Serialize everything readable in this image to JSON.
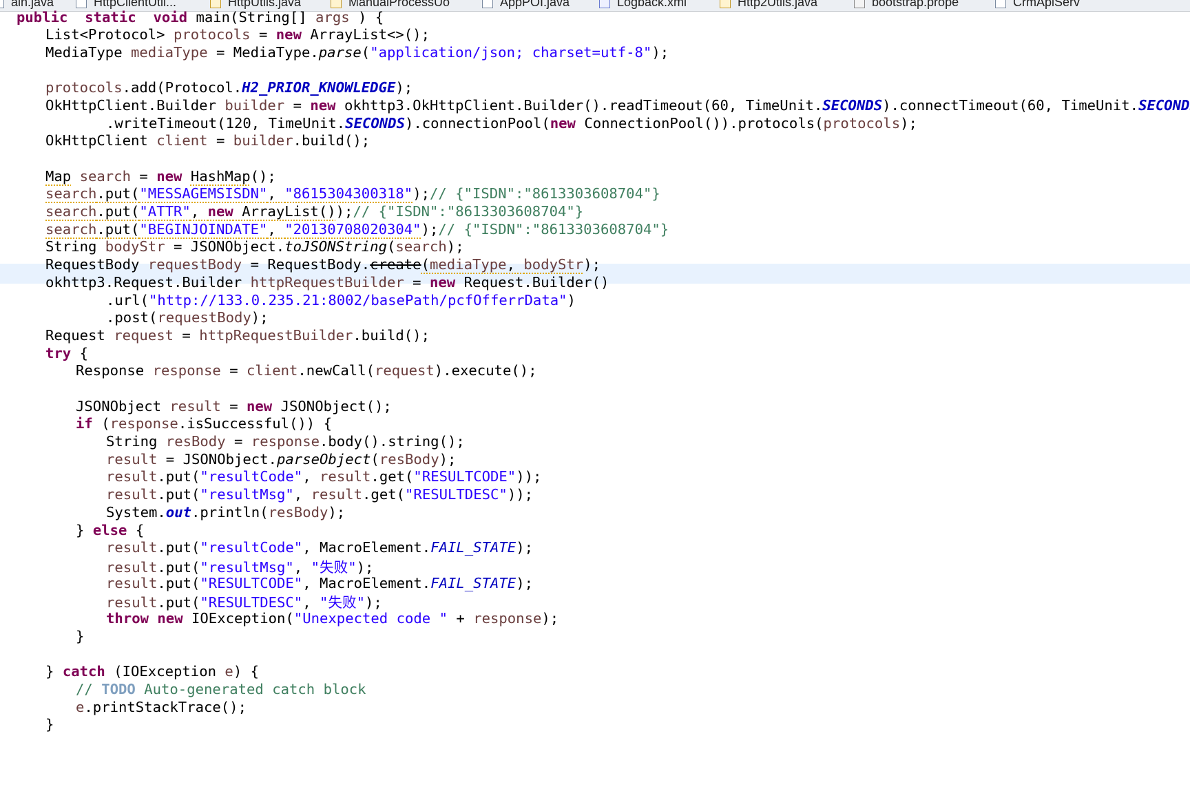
{
  "tabs": [
    {
      "label": "ain.java",
      "icon": "java-file-icon"
    },
    {
      "label": "HttpClientUtil...",
      "icon": "java-file-icon"
    },
    {
      "label": "HttpUtils.java",
      "icon": "java-file-warning-icon"
    },
    {
      "label": "ManualProcessUo",
      "icon": "java-file-warning-icon"
    },
    {
      "label": "AppPOI.java",
      "icon": "java-file-icon"
    },
    {
      "label": "Logback.xml",
      "icon": "xml-file-icon"
    },
    {
      "label": "Http2Utils.java",
      "icon": "java-file-warning-icon"
    },
    {
      "label": "bootstrap.prope",
      "icon": "properties-file-icon"
    },
    {
      "label": "CrmApiServ",
      "icon": "java-file-icon"
    }
  ],
  "code": [
    {
      "indent": 0,
      "tokens": [
        [
          "kw",
          "public"
        ],
        [
          "",
          "  "
        ],
        [
          "kw",
          "static"
        ],
        [
          "",
          "  "
        ],
        [
          "kw",
          "void"
        ],
        [
          "",
          " main(String[] "
        ],
        [
          "var",
          "args"
        ],
        [
          "",
          " ) {"
        ]
      ]
    },
    {
      "indent": 1,
      "tokens": [
        [
          "",
          "List<Protocol> "
        ],
        [
          "var",
          "protocols"
        ],
        [
          "",
          " = "
        ],
        [
          "kw",
          "new"
        ],
        [
          "",
          " ArrayList<>();"
        ]
      ]
    },
    {
      "indent": 1,
      "tokens": [
        [
          "",
          "MediaType "
        ],
        [
          "var",
          "mediaType"
        ],
        [
          "",
          " = MediaType."
        ],
        [
          "smeth",
          "parse"
        ],
        [
          "",
          "("
        ],
        [
          "str",
          "\"application/json; charset=utf-8\""
        ],
        [
          "",
          ");"
        ]
      ]
    },
    {
      "indent": 0,
      "tokens": []
    },
    {
      "indent": 1,
      "tokens": [
        [
          "var",
          "protocols"
        ],
        [
          "",
          ".add(Protocol."
        ],
        [
          "fld",
          "H2_PRIOR_KNOWLEDGE"
        ],
        [
          "",
          ");"
        ]
      ]
    },
    {
      "indent": 1,
      "tokens": [
        [
          "",
          "OkHttpClient.Builder "
        ],
        [
          "var",
          "builder"
        ],
        [
          "",
          " = "
        ],
        [
          "kw",
          "new"
        ],
        [
          "",
          " okhttp3.OkHttpClient.Builder().readTimeout(60, TimeUnit."
        ],
        [
          "fld",
          "SECONDS"
        ],
        [
          "",
          ").connectTimeout(60, TimeUnit."
        ],
        [
          "fld",
          "SECONDS"
        ],
        [
          "",
          ")"
        ]
      ]
    },
    {
      "indent": 3,
      "tokens": [
        [
          "",
          ".writeTimeout(120, TimeUnit."
        ],
        [
          "fld",
          "SECONDS"
        ],
        [
          "",
          ").connectionPool("
        ],
        [
          "kw",
          "new"
        ],
        [
          "",
          " ConnectionPool()).protocols("
        ],
        [
          "var",
          "protocols"
        ],
        [
          "",
          ");"
        ]
      ]
    },
    {
      "indent": 1,
      "tokens": [
        [
          "",
          "OkHttpClient "
        ],
        [
          "var",
          "client"
        ],
        [
          "",
          " = "
        ],
        [
          "var",
          "builder"
        ],
        [
          "",
          ".build();"
        ]
      ]
    },
    {
      "indent": 0,
      "tokens": []
    },
    {
      "indent": 1,
      "tokens": [
        [
          "warnul",
          "Map"
        ],
        [
          "",
          " "
        ],
        [
          "var",
          "search"
        ],
        [
          "",
          " = "
        ],
        [
          "kw",
          "new"
        ],
        [
          "",
          " "
        ],
        [
          "warnul",
          "HashMap"
        ],
        [
          "",
          "();"
        ]
      ]
    },
    {
      "indent": 1,
      "tokens": [
        [
          "warnul var",
          "search"
        ],
        [
          "warnul",
          ".put("
        ],
        [
          "warnul str",
          "\"MESSAGEMSISDN\""
        ],
        [
          "warnul",
          ", "
        ],
        [
          "warnul str",
          "\"8615304300318\""
        ],
        [
          "",
          ");"
        ],
        [
          "cmt",
          "// {\"ISDN\":\"8613303608704\"}"
        ]
      ]
    },
    {
      "indent": 1,
      "tokens": [
        [
          "warnul var",
          "search"
        ],
        [
          "warnul",
          ".put("
        ],
        [
          "warnul str",
          "\"ATTR\""
        ],
        [
          "warnul",
          ", "
        ],
        [
          "warnul kw",
          "new"
        ],
        [
          "warnul",
          " ArrayList()"
        ],
        [
          "",
          ");"
        ],
        [
          "cmt",
          "// {\"ISDN\":\"8613303608704\"}"
        ]
      ]
    },
    {
      "indent": 1,
      "tokens": [
        [
          "warnul var",
          "search"
        ],
        [
          "warnul",
          ".put("
        ],
        [
          "warnul str",
          "\"BEGINJOINDATE\""
        ],
        [
          "warnul",
          ", "
        ],
        [
          "warnul str",
          "\"20130708020304\""
        ],
        [
          "",
          ");"
        ],
        [
          "cmt",
          "// {\"ISDN\":\"8613303608704\"}"
        ]
      ]
    },
    {
      "indent": 1,
      "tokens": [
        [
          "",
          "String "
        ],
        [
          "var",
          "bodyStr"
        ],
        [
          "",
          " = JSONObject."
        ],
        [
          "smeth",
          "toJSONString"
        ],
        [
          "",
          "("
        ],
        [
          "var",
          "search"
        ],
        [
          "",
          ");"
        ]
      ]
    },
    {
      "indent": 1,
      "tokens": [
        [
          "",
          "RequestBody "
        ],
        [
          "var",
          "requestBody"
        ],
        [
          "",
          " = RequestBody."
        ],
        [
          "depr warnul",
          "create"
        ],
        [
          "warnul",
          "("
        ],
        [
          "warnul var",
          "mediaType"
        ],
        [
          "warnul",
          ", "
        ],
        [
          "warnul var",
          "bodyStr"
        ],
        [
          "",
          ");"
        ]
      ]
    },
    {
      "indent": 1,
      "tokens": [
        [
          "",
          "okhttp3.Request.Builder "
        ],
        [
          "var",
          "httpRequestBuilder"
        ],
        [
          "",
          " = "
        ],
        [
          "kw",
          "new"
        ],
        [
          "",
          " Request.Builder()"
        ]
      ]
    },
    {
      "indent": 3,
      "tokens": [
        [
          "",
          ".url("
        ],
        [
          "str",
          "\"http://133.0.235.21:8002/basePath/pcfOfferrData\""
        ],
        [
          "",
          ")"
        ]
      ]
    },
    {
      "indent": 3,
      "tokens": [
        [
          "",
          ".post("
        ],
        [
          "var",
          "requestBody"
        ],
        [
          "",
          ");"
        ]
      ]
    },
    {
      "indent": 1,
      "tokens": [
        [
          "",
          "Request "
        ],
        [
          "var",
          "request"
        ],
        [
          "",
          " = "
        ],
        [
          "var",
          "httpRequestBuilder"
        ],
        [
          "",
          ".build();"
        ]
      ]
    },
    {
      "indent": 1,
      "tokens": [
        [
          "kw",
          "try"
        ],
        [
          "",
          " {"
        ]
      ]
    },
    {
      "indent": 2,
      "tokens": [
        [
          "",
          "Response "
        ],
        [
          "var",
          "response"
        ],
        [
          "",
          " = "
        ],
        [
          "var",
          "client"
        ],
        [
          "",
          ".newCall("
        ],
        [
          "var",
          "request"
        ],
        [
          "",
          ").execute();"
        ]
      ]
    },
    {
      "indent": 0,
      "tokens": []
    },
    {
      "indent": 2,
      "tokens": [
        [
          "",
          "JSONObject "
        ],
        [
          "var",
          "result"
        ],
        [
          "",
          " = "
        ],
        [
          "kw",
          "new"
        ],
        [
          "",
          " JSONObject();"
        ]
      ]
    },
    {
      "indent": 2,
      "tokens": [
        [
          "kw",
          "if"
        ],
        [
          "",
          " ("
        ],
        [
          "var",
          "response"
        ],
        [
          "",
          ".isSuccessful()) {"
        ]
      ]
    },
    {
      "indent": 3,
      "tokens": [
        [
          "",
          "String "
        ],
        [
          "var",
          "resBody"
        ],
        [
          "",
          " = "
        ],
        [
          "var",
          "response"
        ],
        [
          "",
          ".body().string();"
        ]
      ]
    },
    {
      "indent": 3,
      "tokens": [
        [
          "var",
          "result"
        ],
        [
          "",
          " = JSONObject."
        ],
        [
          "smeth",
          "parseObject"
        ],
        [
          "",
          "("
        ],
        [
          "var",
          "resBody"
        ],
        [
          "",
          ");"
        ]
      ]
    },
    {
      "indent": 3,
      "tokens": [
        [
          "var",
          "result"
        ],
        [
          "",
          ".put("
        ],
        [
          "str",
          "\"resultCode\""
        ],
        [
          "",
          ", "
        ],
        [
          "var",
          "result"
        ],
        [
          "",
          ".get("
        ],
        [
          "str",
          "\"RESULTCODE\""
        ],
        [
          "",
          "));"
        ]
      ]
    },
    {
      "indent": 3,
      "tokens": [
        [
          "var",
          "result"
        ],
        [
          "",
          ".put("
        ],
        [
          "str",
          "\"resultMsg\""
        ],
        [
          "",
          ", "
        ],
        [
          "var",
          "result"
        ],
        [
          "",
          ".get("
        ],
        [
          "str",
          "\"RESULTDESC\""
        ],
        [
          "",
          "));"
        ]
      ]
    },
    {
      "indent": 3,
      "tokens": [
        [
          "",
          "System."
        ],
        [
          "fld",
          "out"
        ],
        [
          "",
          ".println("
        ],
        [
          "var",
          "resBody"
        ],
        [
          "",
          ");"
        ]
      ]
    },
    {
      "indent": 2,
      "tokens": [
        [
          "",
          "} "
        ],
        [
          "kw",
          "else"
        ],
        [
          "",
          " {"
        ]
      ]
    },
    {
      "indent": 3,
      "tokens": [
        [
          "var",
          "result"
        ],
        [
          "",
          ".put("
        ],
        [
          "str",
          "\"resultCode\""
        ],
        [
          "",
          ", MacroElement."
        ],
        [
          "sfld",
          "FAIL_STATE"
        ],
        [
          "",
          ");"
        ]
      ]
    },
    {
      "indent": 3,
      "tokens": [
        [
          "var",
          "result"
        ],
        [
          "",
          ".put("
        ],
        [
          "str",
          "\"resultMsg\""
        ],
        [
          "",
          ", "
        ],
        [
          "str",
          "\"失败\""
        ],
        [
          "",
          ");"
        ]
      ]
    },
    {
      "indent": 3,
      "tokens": [
        [
          "var",
          "result"
        ],
        [
          "",
          ".put("
        ],
        [
          "str",
          "\"RESULTCODE\""
        ],
        [
          "",
          ", MacroElement."
        ],
        [
          "sfld",
          "FAIL_STATE"
        ],
        [
          "",
          ");"
        ]
      ]
    },
    {
      "indent": 3,
      "tokens": [
        [
          "var",
          "result"
        ],
        [
          "",
          ".put("
        ],
        [
          "str",
          "\"RESULTDESC\""
        ],
        [
          "",
          ", "
        ],
        [
          "str",
          "\"失败\""
        ],
        [
          "",
          ");"
        ]
      ]
    },
    {
      "indent": 3,
      "tokens": [
        [
          "kw",
          "throw"
        ],
        [
          "",
          " "
        ],
        [
          "kw",
          "new"
        ],
        [
          "",
          " IOException("
        ],
        [
          "str",
          "\"Unexpected code \""
        ],
        [
          "",
          " + "
        ],
        [
          "var",
          "response"
        ],
        [
          "",
          ");"
        ]
      ]
    },
    {
      "indent": 2,
      "tokens": [
        [
          "",
          "}"
        ]
      ]
    },
    {
      "indent": 0,
      "tokens": []
    },
    {
      "indent": 1,
      "tokens": [
        [
          "",
          "} "
        ],
        [
          "kw",
          "catch"
        ],
        [
          "",
          " (IOException "
        ],
        [
          "var",
          "e"
        ],
        [
          "",
          ") {"
        ]
      ]
    },
    {
      "indent": 2,
      "tokens": [
        [
          "cmt",
          "// "
        ],
        [
          "todo",
          "TODO"
        ],
        [
          "cmt",
          " Auto-generated catch block"
        ]
      ]
    },
    {
      "indent": 2,
      "tokens": [
        [
          "var",
          "e"
        ],
        [
          "",
          ".printStackTrace();"
        ]
      ]
    },
    {
      "indent": 1,
      "tokens": [
        [
          "",
          "}"
        ]
      ]
    }
  ]
}
